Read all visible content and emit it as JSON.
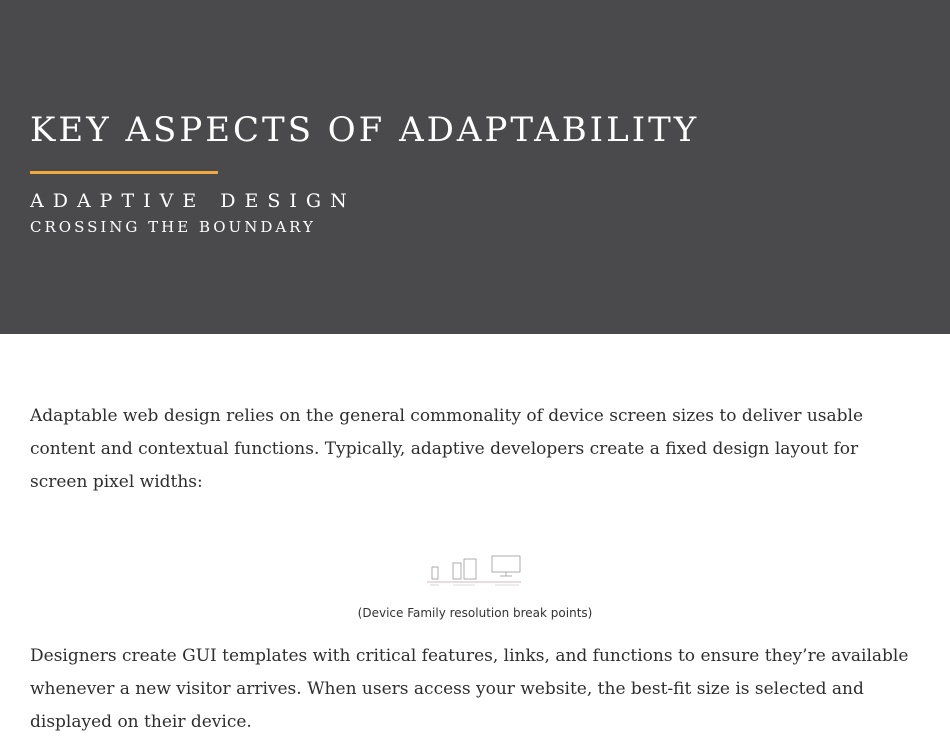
{
  "hero": {
    "title": "KEY ASPECTS OF ADAPTABILITY",
    "subtitle": "ADAPTIVE DESIGN",
    "tagline": "CROSSING THE BOUNDARY",
    "background_color": "#4a4a4d",
    "accent_color": "#f0a93a"
  },
  "content": {
    "paragraph_1": "Adaptable web design relies on the general commonality of device screen sizes to deliver usable content and contextual functions. Typically, adaptive developers create a fixed design layout for screen pixel widths:",
    "figure_icon": "device-family-breakpoints-icon",
    "figure_caption": "(Device Family resolution break points)",
    "paragraph_2": "Designers create GUI templates with critical features, links, and functions to ensure they’re available whenever a new visitor arrives. When users access your website, the best-fit size is selected and displayed on their device."
  }
}
